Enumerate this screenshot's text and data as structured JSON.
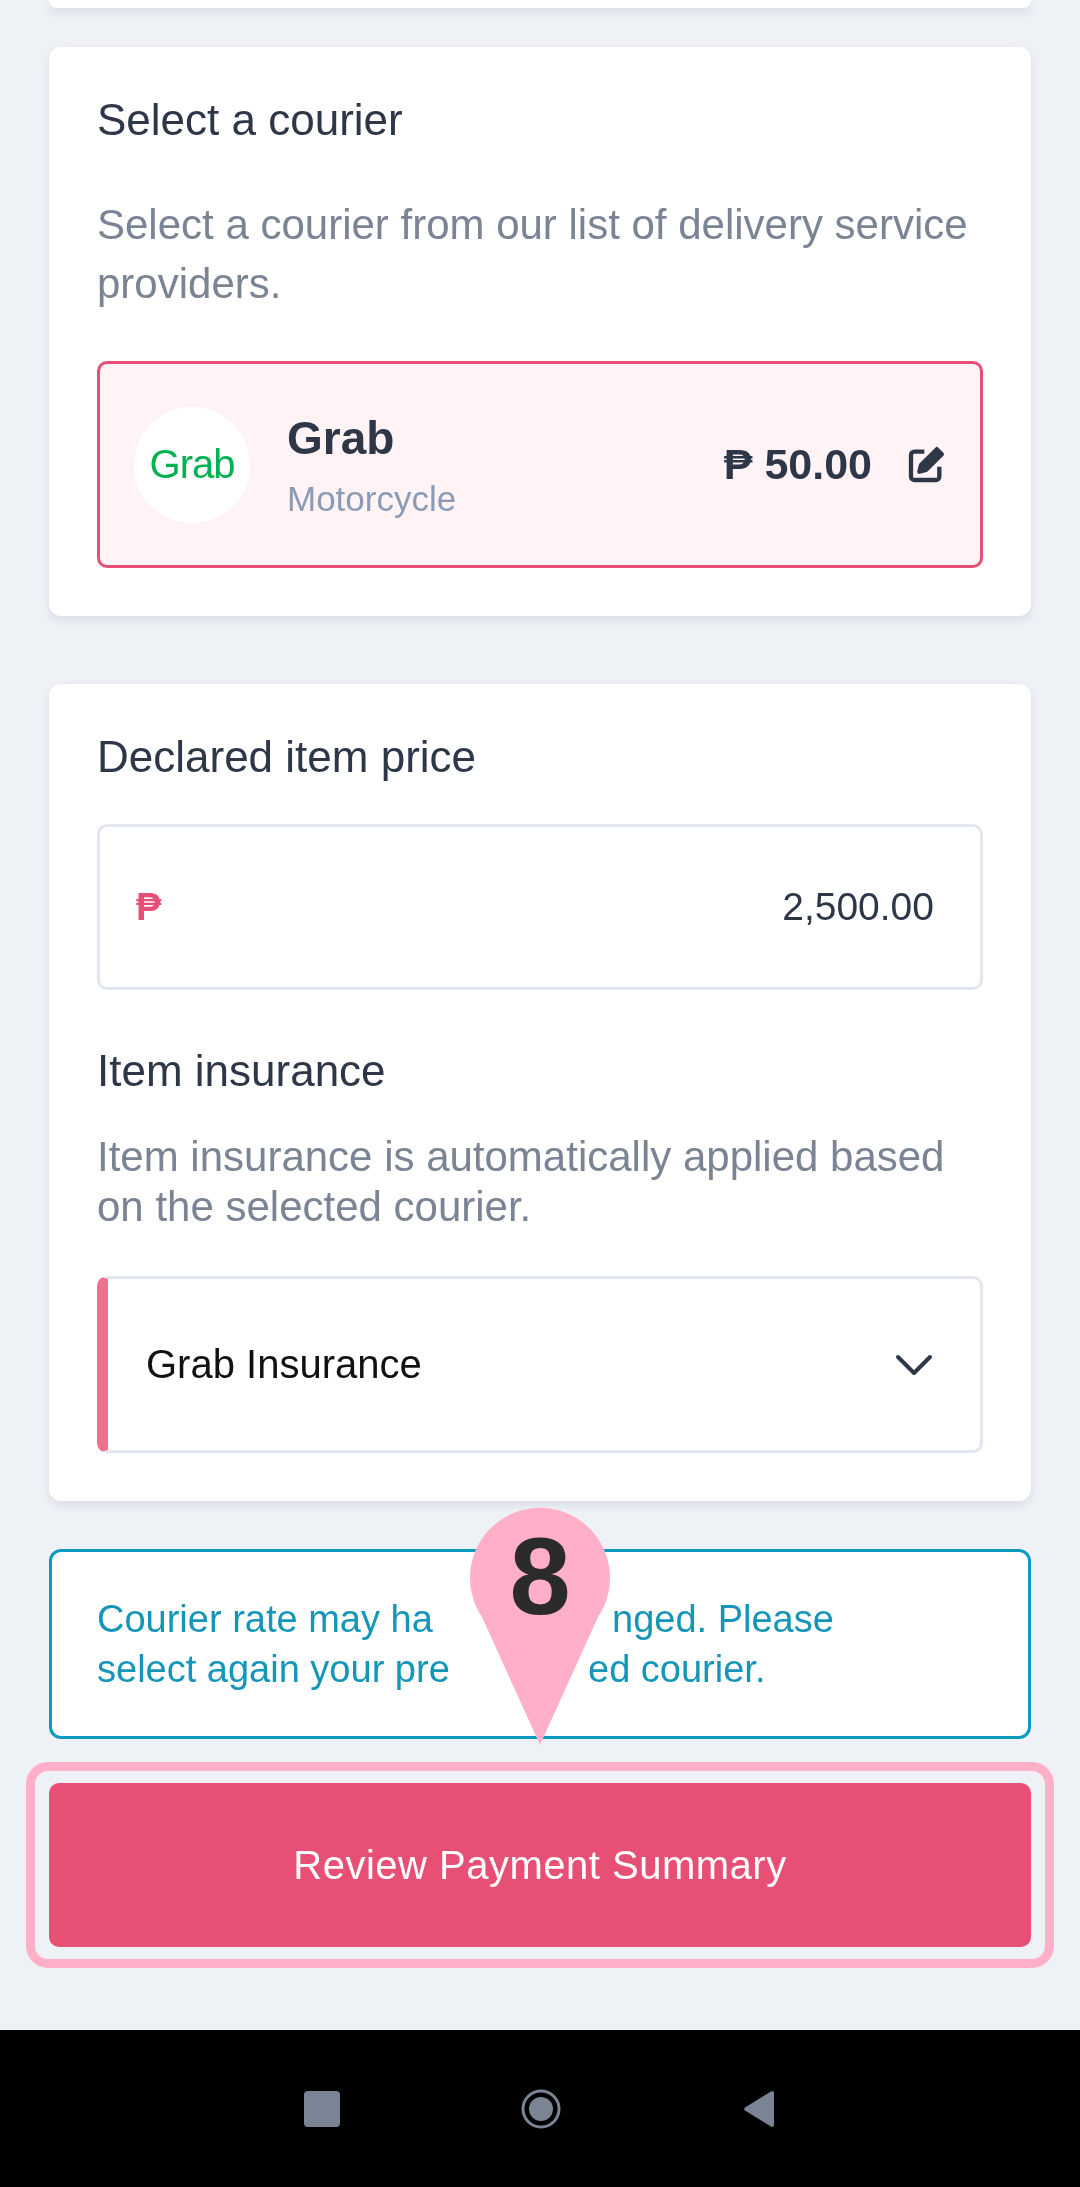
{
  "courier_card": {
    "title": "Select a courier",
    "description": "Select a courier from our list of delivery service providers.",
    "selected_courier": {
      "logo": "Grab",
      "name": "Grab",
      "vehicle": "Motorcycle",
      "price": "₱ 50.00",
      "selected": true
    }
  },
  "price_card": {
    "title": "Declared item price",
    "price_field": {
      "currency": "₱",
      "value": "2,500.00"
    },
    "insurance_title": "Item insurance",
    "insurance_description": "Item insurance is automatically applied based on the selected courier.",
    "insurance_select": {
      "value": "Grab Insurance"
    }
  },
  "notice": {
    "lines": [
      [
        "Courier rate may ha",
        "nged. Please"
      ],
      [
        "select again your pre",
        "ed courier."
      ]
    ]
  },
  "annotation": {
    "number": "8"
  },
  "primary_button": {
    "label": "Review Payment Summary"
  }
}
